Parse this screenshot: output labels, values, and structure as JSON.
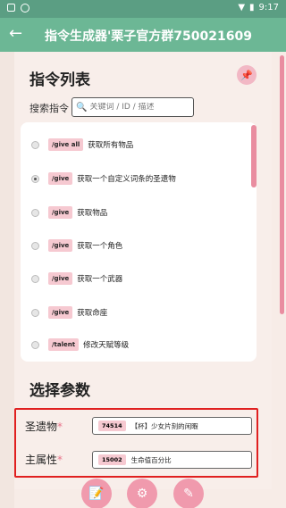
{
  "status_bar": {
    "time": "9:17",
    "icons_left": [
      "sim-icon",
      "sync-icon"
    ],
    "icons_right": [
      "wifi-icon",
      "battery-icon"
    ]
  },
  "app_bar": {
    "back_icon": "arrow-left-icon",
    "title": "指令生成器'栗子官方群750021609"
  },
  "command_list": {
    "title": "指令列表",
    "pin_icon": "pin-icon",
    "search": {
      "label": "搜索指令",
      "placeholder": "关键词 / ID / 描述"
    },
    "items": [
      {
        "tag": "/give all",
        "desc": "获取所有物品",
        "selected": false
      },
      {
        "tag": "/give",
        "desc": "获取一个自定义词条的圣遗物",
        "selected": true
      },
      {
        "tag": "/give",
        "desc": "获取物品",
        "selected": false
      },
      {
        "tag": "/give",
        "desc": "获取一个角色",
        "selected": false
      },
      {
        "tag": "/give",
        "desc": "获取一个武器",
        "selected": false
      },
      {
        "tag": "/give",
        "desc": "获取命座",
        "selected": false
      },
      {
        "tag": "/talent",
        "desc": "修改天赋等级",
        "selected": false
      }
    ]
  },
  "params": {
    "title": "选择参数",
    "fields": [
      {
        "label": "圣遗物",
        "code": "74514",
        "value": "【杯】少女片刻的闲暇"
      },
      {
        "label": "主属性",
        "code": "15002",
        "value": "生命值百分比"
      }
    ]
  },
  "bottom_nav": [
    {
      "name": "edit-doc-icon",
      "glyph": "📝"
    },
    {
      "name": "settings-icon",
      "glyph": "⚙"
    },
    {
      "name": "pencil-icon",
      "glyph": "✎"
    }
  ],
  "colors": {
    "app_bar": "#6cb795",
    "status_bar": "#5b9e83",
    "accent_pink": "#f09aad",
    "tag_pink": "#f6c9d1",
    "highlight_red": "#e02020"
  }
}
